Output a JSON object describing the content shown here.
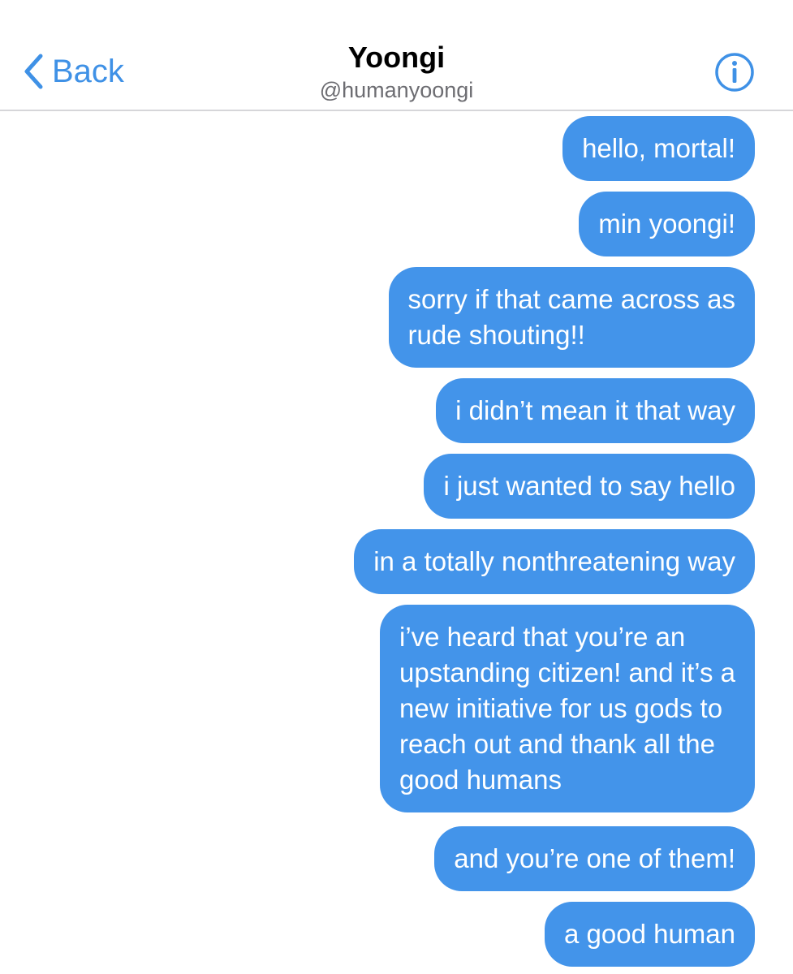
{
  "header": {
    "back_label": "Back",
    "title": "Yoongi",
    "handle": "@humanyoongi",
    "accent_color": "#3f91e6",
    "back_icon": "chevron-left-icon",
    "info_icon": "info-icon"
  },
  "bubble_color": "#4394ea",
  "messages": [
    {
      "text": "hello, mortal!"
    },
    {
      "text": "min yoongi!"
    },
    {
      "text": "sorry if that came across as\nrude shouting!!"
    },
    {
      "text": "i didn’t mean it that way"
    },
    {
      "text": "i just wanted to say hello"
    },
    {
      "text": "in a totally nonthreatening way"
    },
    {
      "text": "i’ve heard that you’re an\nupstanding citizen! and it’s a\nnew initiative for us gods to\nreach out and thank all the\ngood humans"
    },
    {
      "text": "and you’re one of them!"
    },
    {
      "text": "a good human"
    }
  ]
}
